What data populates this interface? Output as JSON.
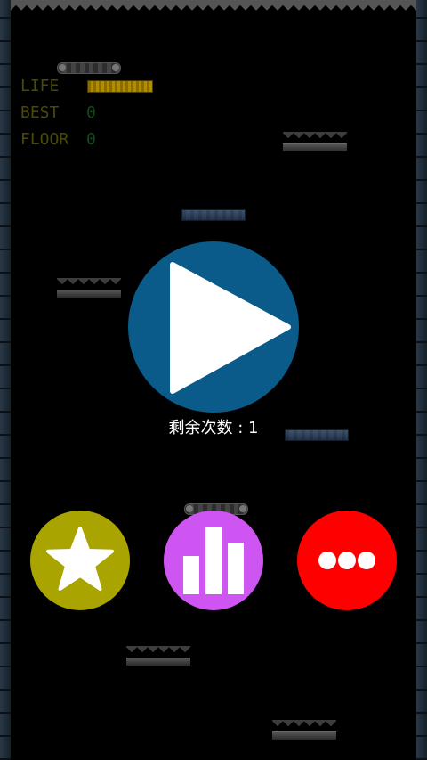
{
  "hud": {
    "life_label": "LIFE",
    "life_level": 1.0,
    "best_label": "BEST",
    "best_value": "0",
    "floor_label": "FLOOR",
    "floor_value": "0"
  },
  "play": {
    "icon": "play-icon",
    "remaining_label": "剩余次数 : 1"
  },
  "buttons": [
    {
      "name": "rate",
      "icon": "star-icon",
      "color": "#a9a400"
    },
    {
      "name": "leaderboard",
      "icon": "bar-chart-icon",
      "color": "#cf55f2"
    },
    {
      "name": "more",
      "icon": "more-dots-icon",
      "color": "#ff0000"
    }
  ],
  "colors": {
    "play": "#0a5a8a",
    "hud_text": "#4a4a00",
    "hud_value": "#0b4d16"
  }
}
